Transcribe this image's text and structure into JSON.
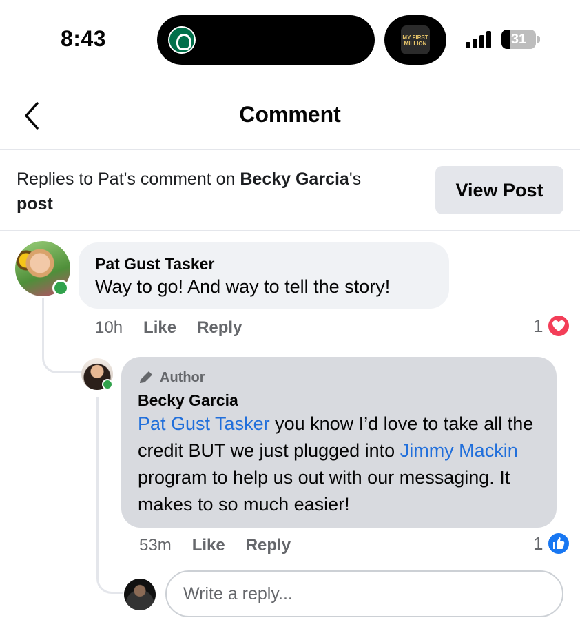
{
  "status_bar": {
    "time": "8:43",
    "battery": "31",
    "podcast_art_text": "MY FIRST MILLION"
  },
  "header": {
    "title": "Comment",
    "back_icon": "chevron-left-icon"
  },
  "context": {
    "prefix": "Replies to Pat's comment on ",
    "author": "Becky Garcia",
    "suffix": "'s",
    "post_word": "post",
    "view_post_label": "View Post"
  },
  "comment": {
    "name": "Pat Gust Tasker",
    "text": "Way to go!  And way to tell the story!",
    "time": "10h",
    "like_label": "Like",
    "reply_label": "Reply",
    "reaction_count": "1",
    "reaction_icon": "heart-icon"
  },
  "reply": {
    "badge": "Author",
    "name": "Becky Garcia",
    "mention1": "Pat Gust Tasker",
    "text1": " you know I’d love to take all the credit BUT we just plugged into ",
    "mention2": "Jimmy Mackin",
    "text2": " program to help us out with our messaging. It makes to so much easier!",
    "time": "53m",
    "like_label": "Like",
    "reply_label": "Reply",
    "reaction_count": "1",
    "reaction_icon": "thumbs-up-icon"
  },
  "composer": {
    "placeholder": "Write a reply..."
  },
  "colors": {
    "online": "#31a24c",
    "heart": "#f33e58",
    "like": "#1877f2",
    "mention": "#216fdb"
  }
}
